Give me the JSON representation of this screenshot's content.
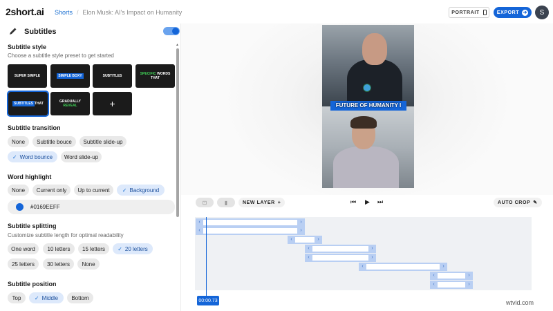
{
  "header": {
    "logo": "2short.ai",
    "breadcrumb_root": "Shorts",
    "breadcrumb_sep": "/",
    "breadcrumb_current": "Elon Musk: AI's Impact on Humanity",
    "portrait_label": "PORTRAIT",
    "export_label": "EXPORT",
    "avatar_initial": "S"
  },
  "panel": {
    "title": "Subtitles",
    "toggle_on": true,
    "style": {
      "title": "Subtitle style",
      "subtitle": "Choose a subtitle style preset to get started",
      "presets": {
        "p1": "SUPER SIMPLE",
        "p2": "SIMPLE BOXY",
        "p3": "SUBTITLES",
        "p4a": "SPECIFIC",
        "p4b": "WORDS THAT",
        "p5a": "SUBTITLES",
        "p5b": "THAT",
        "p6a": "GRADUALLY",
        "p6b": "REVEAL",
        "add": "+"
      }
    },
    "transition": {
      "title": "Subtitle transition",
      "options": [
        "None",
        "Subtitle bouce",
        "Subtitle slide-up",
        "Word bounce",
        "Word slide-up"
      ],
      "selected": "Word bounce"
    },
    "highlight": {
      "title": "Word highlight",
      "options": [
        "None",
        "Current only",
        "Up to current",
        "Background"
      ],
      "selected": "Background",
      "color_value": "#0169EEFF",
      "color_hex": "#1465d8"
    },
    "splitting": {
      "title": "Subtitle splitting",
      "subtitle": "Customize subtitle length for optimal readability",
      "options": [
        "One word",
        "10 letters",
        "15 letters",
        "20 letters",
        "25 letters",
        "30 letters",
        "None"
      ],
      "selected": "20 letters"
    },
    "position": {
      "title": "Subtitle position",
      "options": [
        "Top",
        "Middle",
        "Bottom"
      ],
      "selected": "Middle"
    }
  },
  "preview": {
    "caption": "FUTURE OF HUMANITY I"
  },
  "toolbar": {
    "new_layer": "NEW LAYER",
    "auto_crop": "AUTO CROP"
  },
  "timeline": {
    "time": "00:00.73"
  },
  "watermark": "wtvid.com",
  "colors": {
    "accent": "#1465d8"
  }
}
